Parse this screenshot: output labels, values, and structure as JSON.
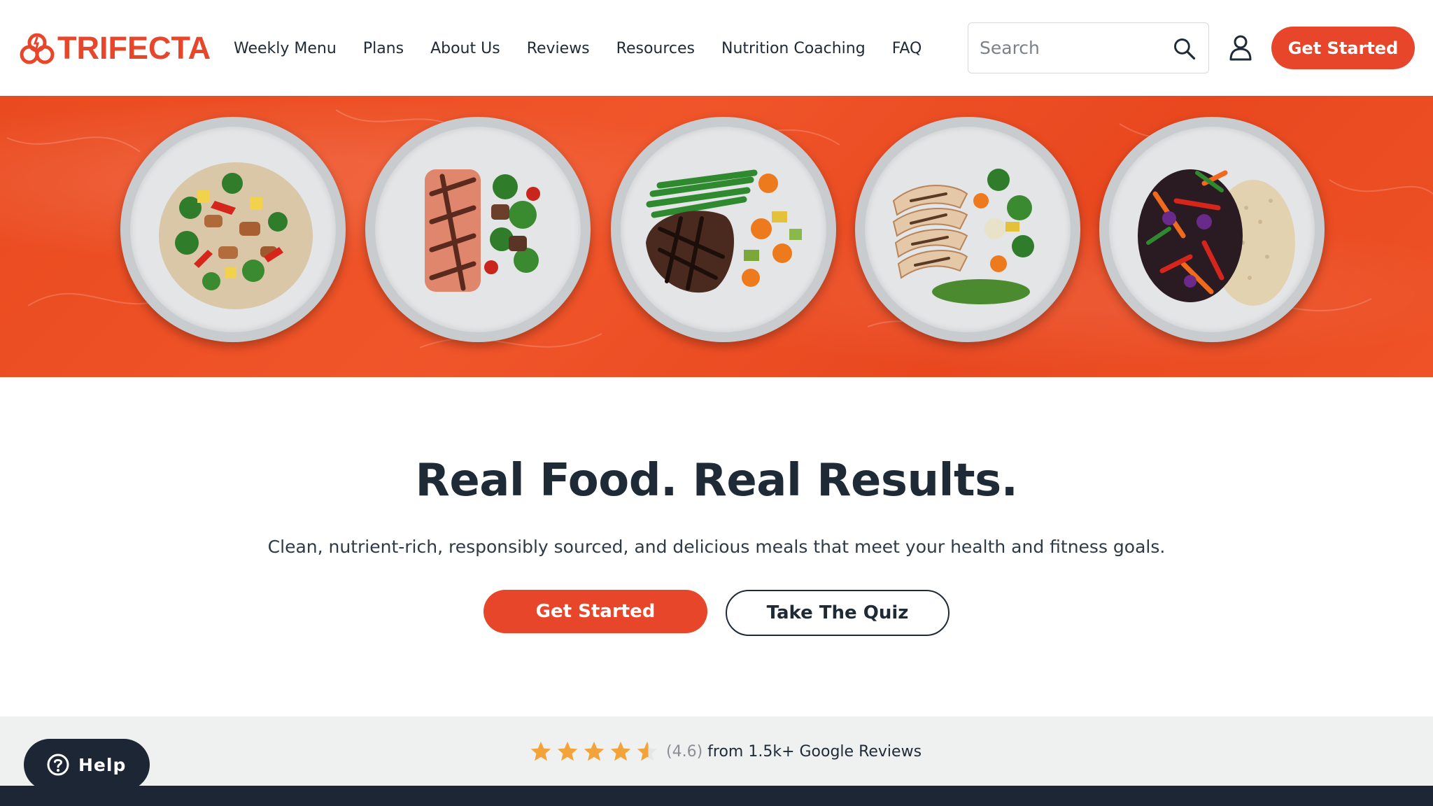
{
  "brand": {
    "name": "TRIFECTA",
    "accent": "#e8462a",
    "dark": "#1f2a37"
  },
  "nav": {
    "items": [
      {
        "label": "Weekly Menu"
      },
      {
        "label": "Plans"
      },
      {
        "label": "About Us"
      },
      {
        "label": "Reviews"
      },
      {
        "label": "Resources"
      },
      {
        "label": "Nutrition Coaching"
      },
      {
        "label": "FAQ"
      }
    ]
  },
  "search": {
    "placeholder": "Search",
    "icon": "search-icon"
  },
  "account": {
    "icon": "user-icon"
  },
  "header_cta": {
    "label": "Get Started"
  },
  "hero": {
    "plates": [
      {
        "dish": "chicken stir-fry with broccoli and peppers"
      },
      {
        "dish": "grilled salmon with roasted vegetables"
      },
      {
        "dish": "grilled steak with green beans and vegetables"
      },
      {
        "dish": "sliced grilled chicken with mixed vegetables"
      },
      {
        "dish": "black beans, vegetables and brown rice"
      }
    ]
  },
  "main": {
    "headline": "Real Food. Real Results.",
    "subline": "Clean, nutrient-rich, responsibly sourced, and delicious meals that meet your health and fitness goals.",
    "cta_primary": "Get Started",
    "cta_secondary": "Take The Quiz"
  },
  "reviews": {
    "rating_value": 4.6,
    "rating_text": "(4.6)",
    "text": "from 1.5k+ Google Reviews",
    "star_color": "#f2a33a"
  },
  "help": {
    "label": "Help",
    "icon": "question-circle-icon"
  }
}
